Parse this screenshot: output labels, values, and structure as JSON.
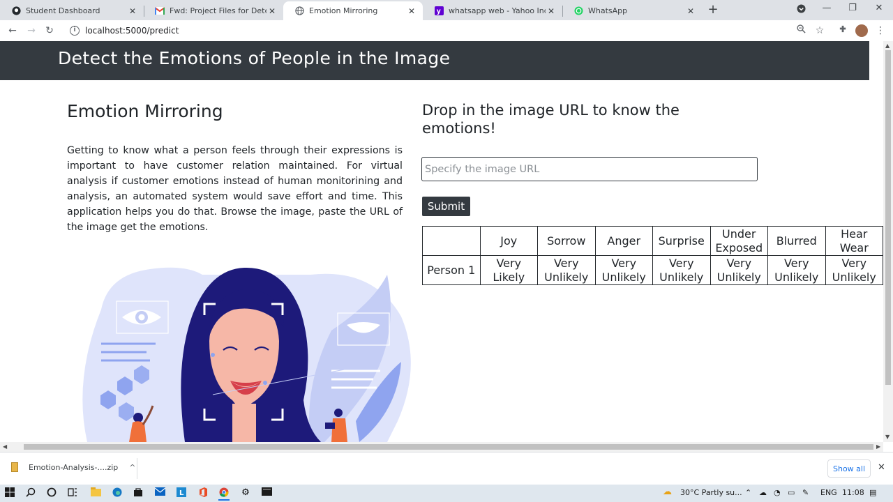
{
  "browser": {
    "tabs": [
      {
        "title": "Student Dashboard",
        "icon": "github-icon"
      },
      {
        "title": "Fwd: Project Files for Detect face",
        "icon": "gmail-icon"
      },
      {
        "title": "Emotion Mirroring",
        "icon": "globe-icon"
      },
      {
        "title": "whatsapp web - Yahoo India Sear",
        "icon": "yahoo-icon"
      },
      {
        "title": "WhatsApp",
        "icon": "whatsapp-icon"
      }
    ],
    "active_tab": 2,
    "url": "localhost:5000/predict"
  },
  "header": {
    "title": "Detect the Emotions of People in the Image"
  },
  "main": {
    "app_title": "Emotion Mirroring",
    "description": "Getting to know what a person feels through their expressions is important to have customer relation maintained. For virtual analysis if customer emotions instead of human monitorining and analysis, an automated system would save effort and time. This application helps you do that. Browse the image, paste the URL of the image get the emotions.",
    "prompt": "Drop in the image URL to know the emotions!",
    "url_placeholder": "Specify the image URL",
    "submit_label": "Submit",
    "table": {
      "headers": [
        "",
        "Joy",
        "Sorrow",
        "Anger",
        "Surprise",
        "Under Exposed",
        "Blurred",
        "Hear Wear"
      ],
      "rows": [
        {
          "label": "Person 1",
          "values": [
            "Very Likely",
            "Very Unlikely",
            "Very Unlikely",
            "Very Unlikely",
            "Very Unlikely",
            "Very Unlikely",
            "Very Unlikely"
          ]
        }
      ]
    }
  },
  "downloads": {
    "file": "Emotion-Analysis-....zip",
    "show_all": "Show all"
  },
  "taskbar": {
    "weather": "30°C  Partly su...",
    "lang": "ENG",
    "time": "11:08"
  },
  "colors": {
    "header_bg": "#343a40",
    "button_bg": "#343a40",
    "tabstrip": "#dee1e6"
  }
}
